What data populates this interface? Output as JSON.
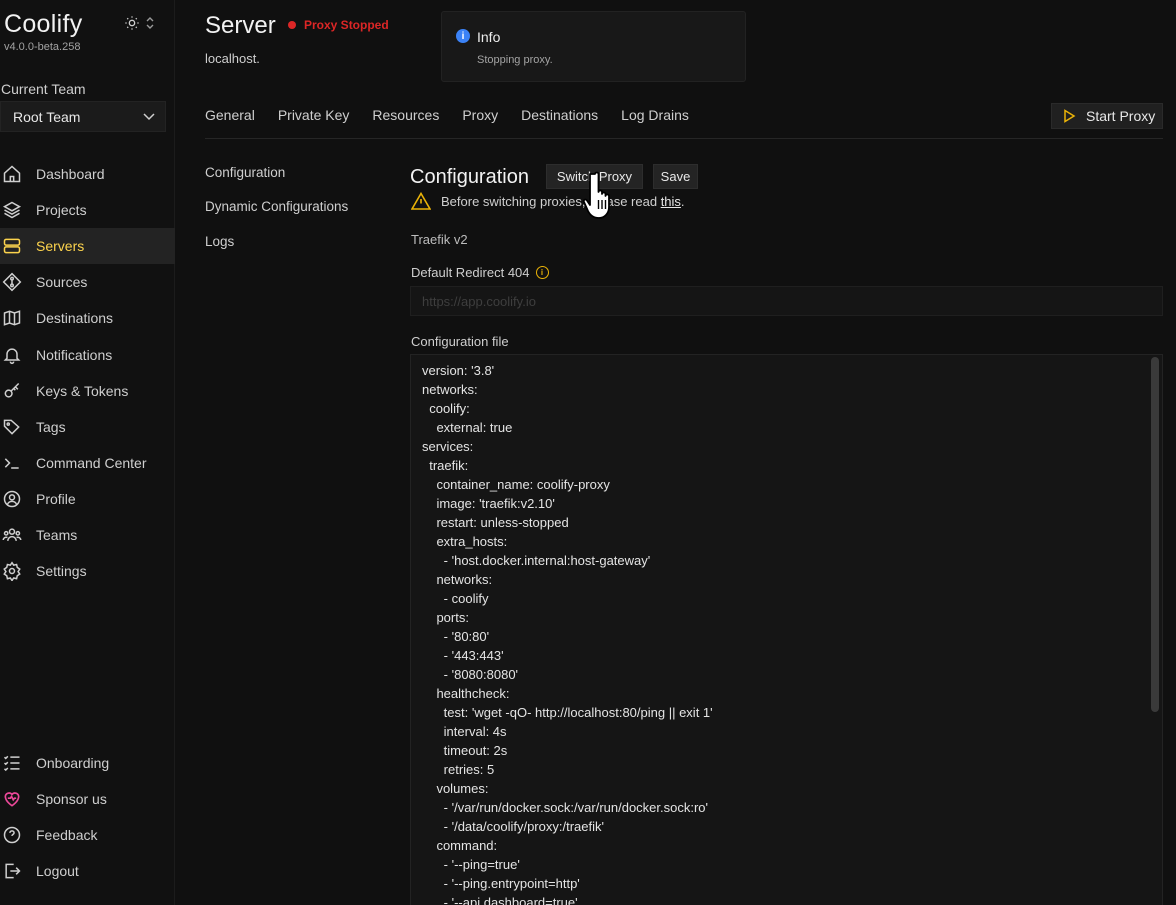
{
  "brand": {
    "name": "Coolify",
    "version": "v4.0.0-beta.258"
  },
  "team": {
    "label": "Current Team",
    "selected": "Root Team"
  },
  "sidebar": {
    "items": [
      {
        "label": "Dashboard",
        "icon": "home-icon"
      },
      {
        "label": "Projects",
        "icon": "layers-icon"
      },
      {
        "label": "Servers",
        "icon": "server-icon",
        "active": true
      },
      {
        "label": "Sources",
        "icon": "git-icon"
      },
      {
        "label": "Destinations",
        "icon": "destinations-icon"
      },
      {
        "label": "Notifications",
        "icon": "bell-icon"
      },
      {
        "label": "Keys & Tokens",
        "icon": "key-icon"
      },
      {
        "label": "Tags",
        "icon": "tag-icon"
      },
      {
        "label": "Command Center",
        "icon": "terminal-icon"
      },
      {
        "label": "Profile",
        "icon": "user-icon"
      },
      {
        "label": "Teams",
        "icon": "users-icon"
      },
      {
        "label": "Settings",
        "icon": "gear-icon"
      }
    ],
    "bottom": [
      {
        "label": "Onboarding",
        "icon": "checklist-icon"
      },
      {
        "label": "Sponsor us",
        "icon": "heart-icon",
        "color": "#ec4899"
      },
      {
        "label": "Feedback",
        "icon": "help-icon"
      },
      {
        "label": "Logout",
        "icon": "logout-icon"
      }
    ]
  },
  "header": {
    "title": "Server",
    "status": "Proxy Stopped",
    "status_color": "#dc2626",
    "subtitle": "localhost."
  },
  "toast": {
    "title": "Info",
    "message": "Stopping proxy."
  },
  "tabs": [
    "General",
    "Private Key",
    "Resources",
    "Proxy",
    "Destinations",
    "Log Drains"
  ],
  "start_proxy_label": "Start Proxy",
  "subnav": [
    "Configuration",
    "Dynamic Configurations",
    "Logs"
  ],
  "config": {
    "title": "Configuration",
    "switch_label": "Switch Proxy",
    "save_label": "Save",
    "warning_prefix": "Before switching proxies, please read",
    "warning_link": "this",
    "warning_suffix": ".",
    "proxy_type": "Traefik v2",
    "redirect_label": "Default Redirect 404",
    "redirect_placeholder": "https://app.coolify.io",
    "redirect_value": "",
    "file_label": "Configuration file",
    "file_content": "version: '3.8'\nnetworks:\n  coolify:\n    external: true\nservices:\n  traefik:\n    container_name: coolify-proxy\n    image: 'traefik:v2.10'\n    restart: unless-stopped\n    extra_hosts:\n      - 'host.docker.internal:host-gateway'\n    networks:\n      - coolify\n    ports:\n      - '80:80'\n      - '443:443'\n      - '8080:8080'\n    healthcheck:\n      test: 'wget -qO- http://localhost:80/ping || exit 1'\n      interval: 4s\n      timeout: 2s\n      retries: 5\n    volumes:\n      - '/var/run/docker.sock:/var/run/docker.sock:ro'\n      - '/data/coolify/proxy:/traefik'\n    command:\n      - '--ping=true'\n      - '--ping.entrypoint=http'\n      - '--api.dashboard=true'"
  },
  "colors": {
    "accent": "#fcd34d",
    "info": "#3b82f6",
    "warning": "#eab308"
  }
}
